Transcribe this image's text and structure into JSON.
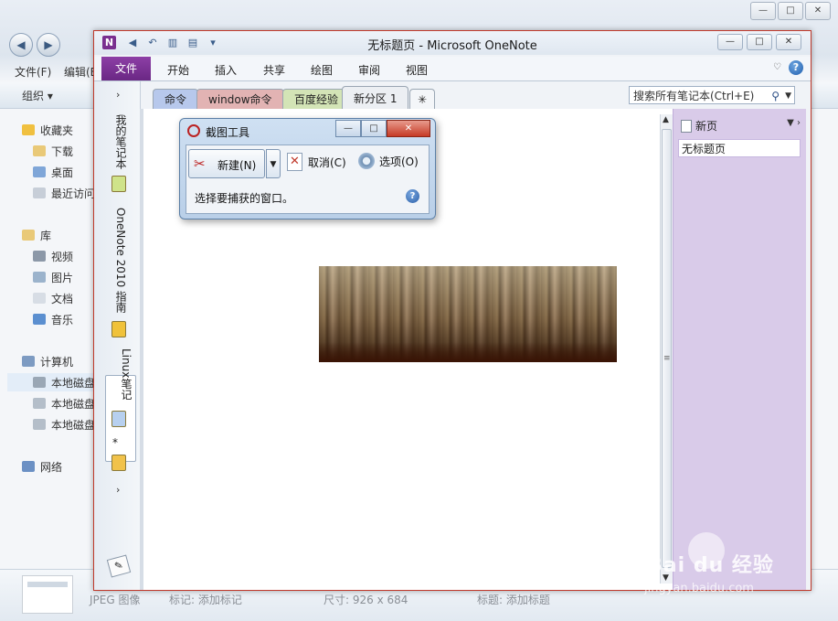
{
  "explorer": {
    "caption_buttons": [
      "—",
      "□",
      "✕"
    ],
    "menu": [
      "文件(F)",
      "编辑(E)"
    ],
    "toolbar_organize": "组织 ▾",
    "tree": {
      "favorites": "收藏夹",
      "downloads": "下载",
      "desktop": "桌面",
      "recent": "最近访问",
      "libraries": "库",
      "videos": "视频",
      "pictures": "图片",
      "documents": "文档",
      "music": "音乐",
      "computer": "计算机",
      "disk1": "本地磁盘",
      "disk2": "本地磁盘",
      "disk3": "本地磁盘",
      "network": "网络"
    },
    "status": {
      "type": "JPEG 图像",
      "tags": "标记: 添加标记",
      "dimensions": "尺寸: 926 x 684",
      "title": "标题: 添加标题"
    }
  },
  "onenote": {
    "title": "无标题页 - Microsoft OneNote",
    "logo": "N",
    "window_buttons": [
      "—",
      "□",
      "✕"
    ],
    "ribbon_tabs": {
      "file": "文件",
      "home": "开始",
      "insert": "插入",
      "share": "共享",
      "draw": "绘图",
      "review": "审阅",
      "view": "视图"
    },
    "notebooks": {
      "my_notebook": "我的笔记本",
      "guide": "OneNote 2010 指南",
      "linux": "Linux笔记"
    },
    "section_tabs": [
      "命令",
      "window命令",
      "百度经验",
      "新分区 1"
    ],
    "section_tab_colors": [
      "#b7c8ec",
      "#e2b3b3",
      "#d3e4b6",
      "#eceff3"
    ],
    "search_placeholder": "搜索所有笔记本(Ctrl+E)",
    "new_page": "新页",
    "pages": [
      "无标题页"
    ]
  },
  "snipping_tool": {
    "title": "截图工具",
    "new_label": "新建(N)",
    "cancel_label": "取消(C)",
    "options_label": "选项(O)",
    "hint": "选择要捕获的窗口。"
  },
  "watermark": {
    "brand": "Bai du 经验",
    "url": "jingyan.baidu.com"
  },
  "colors": {
    "onenote_purple": "#7a2f8f",
    "page_panel": "#d9cbe9",
    "window_border": "#c0392b"
  }
}
